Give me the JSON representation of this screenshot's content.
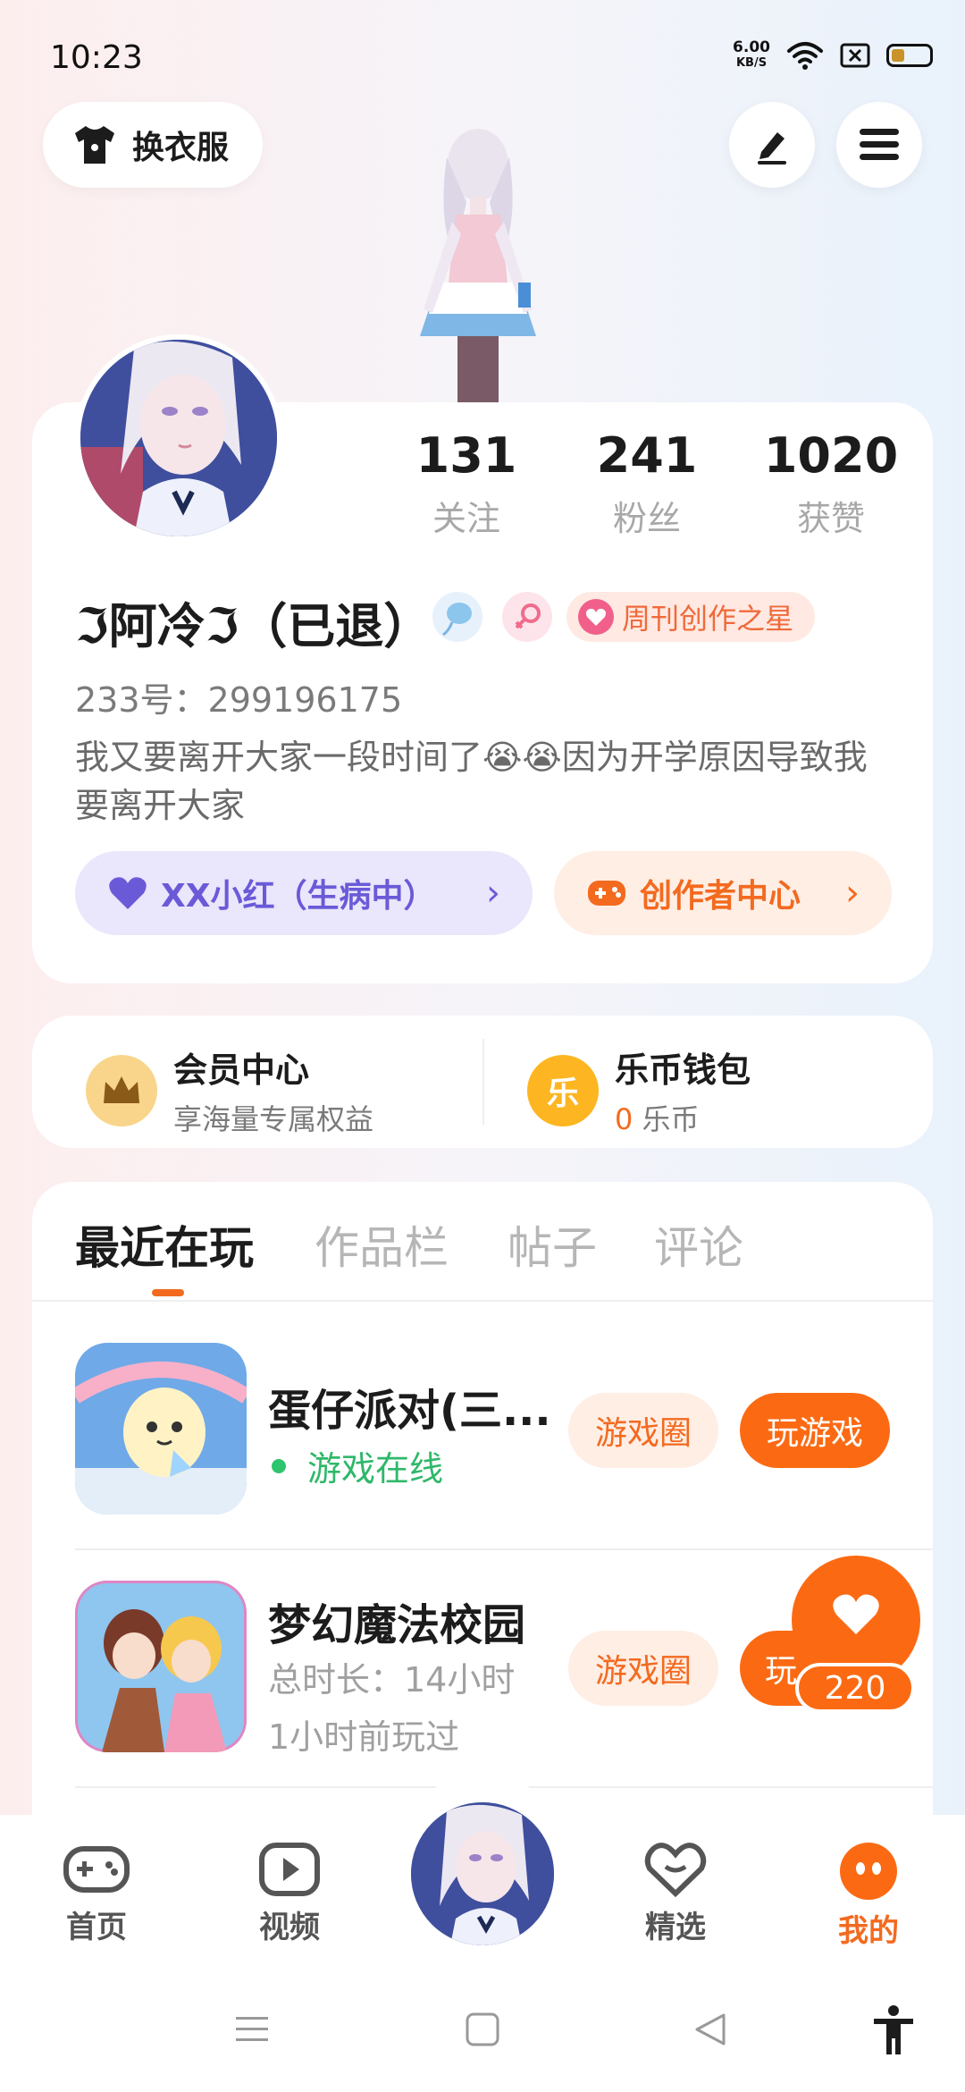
{
  "status_bar": {
    "time": "10:23",
    "net_speed_value": "6.00",
    "net_speed_unit": "KB/S"
  },
  "header": {
    "outfit_label": "换衣服",
    "icons": [
      "tshirt-icon",
      "edit-pen-icon",
      "menu-icon"
    ]
  },
  "profile": {
    "stats": [
      {
        "value": "131",
        "label": "关注"
      },
      {
        "value": "241",
        "label": "粉丝"
      },
      {
        "value": "1020",
        "label": "获赞"
      }
    ],
    "nickname": "ℑ阿冷ℑ（已退）",
    "badge_label": "周刊创作之星",
    "uid": "233号：299196175",
    "bio": "我又要离开大家一段时间了😭😭因为开学原因导致我要离开大家",
    "partner_button": "XX小红（生病中）",
    "creator_button": "创作者中心"
  },
  "membership": {
    "vip_title": "会员中心",
    "vip_sub": "享海量专属权益",
    "wallet_title": "乐币钱包",
    "wallet_amount": "0",
    "wallet_unit": "乐币",
    "wallet_icon_char": "乐"
  },
  "tabs": [
    {
      "label": "最近在玩",
      "active": true
    },
    {
      "label": "作品栏",
      "active": false
    },
    {
      "label": "帖子",
      "active": false
    },
    {
      "label": "评论",
      "active": false
    }
  ],
  "games": [
    {
      "title": "蛋仔派对(三...",
      "status": "游戏在线",
      "circle_label": "游戏圈",
      "play_label": "玩游戏"
    },
    {
      "title": "梦幻魔法校园",
      "duration": "总时长：14小时",
      "last_played": "1小时前玩过",
      "circle_label": "游戏圈",
      "play_label": "玩"
    }
  ],
  "floating_like": {
    "count": "220"
  },
  "bottom_nav": [
    {
      "label": "首页",
      "icon": "gamepad-icon"
    },
    {
      "label": "视频",
      "icon": "play-icon"
    },
    {
      "label": "精选",
      "icon": "heart-badge-icon"
    },
    {
      "label": "我的",
      "icon": "face-icon",
      "active": true
    }
  ],
  "colors": {
    "accent": "#fb6a13",
    "purple": "#6a5ad8",
    "online_green": "#2fb86a"
  }
}
